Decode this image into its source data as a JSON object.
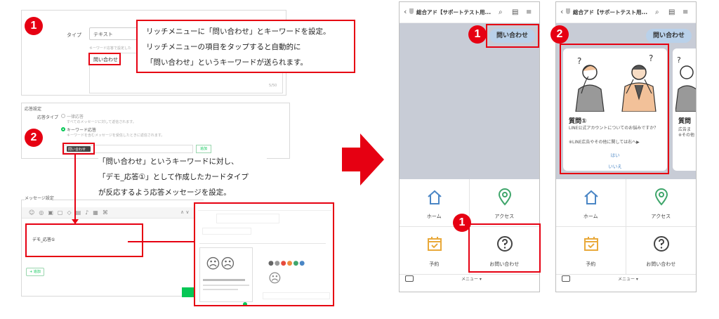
{
  "badges": [
    "1",
    "2"
  ],
  "top_panel": {
    "type_label": "タイプ",
    "type_value": "テキスト",
    "hint": "キーワード応答で設定した",
    "keyword": "問い合わせ",
    "counter": "5/50"
  },
  "callout1": {
    "line1": "リッチメニューに「問い合わせ」とキーワードを設定。",
    "line2": "リッチメニューの項目をタップすると自動的に",
    "line3": "「問い合わせ」というキーワードが送られます。"
  },
  "response_panel": {
    "heading": "応答設定",
    "type_label": "応答タイプ",
    "option1": "一律応答",
    "option1_hint": "すべてのメッセージに対して返信されます。",
    "option2": "キーワード応答",
    "option2_hint": "キーワードを含むメッセージを受信したときに返信されます。",
    "tag": "問い合わせ",
    "add_label": "追加"
  },
  "callout2": {
    "line1": "「問い合わせ」というキーワードに対し、",
    "line2": "「デモ_応答①」として作成したカードタイプ",
    "line3": "が反応するよう応答メッセージを設定。"
  },
  "message_panel": {
    "heading": "メッセージ設定",
    "message_item": "デモ_応答①",
    "add_button": "+ 追加"
  },
  "phone1": {
    "title": "総合アド【サポートテスト用...",
    "keyword_bubble": "問い合わせ",
    "menu": [
      {
        "label": "ホーム"
      },
      {
        "label": "アクセス"
      },
      {
        "label": "予約"
      },
      {
        "label": "お問い合わせ"
      }
    ],
    "footer": "メニュー ▾"
  },
  "phone2": {
    "title": "総合アド【サポートテスト用...",
    "keyword_bubble": "問い合わせ",
    "card": {
      "title": "質問①",
      "body1": "LINE公式アカウントについてのお悩みですか？",
      "body2": "※LINE広告やその他に関しては右へ▶",
      "yes": "はい",
      "no": "いいえ"
    },
    "card2": {
      "title": "質問",
      "body1": "広告ま",
      "body2": "※その他"
    },
    "menu": [
      {
        "label": "ホーム"
      },
      {
        "label": "アクセス"
      },
      {
        "label": "予約"
      },
      {
        "label": "お問い合わせ"
      }
    ],
    "footer": "メニュー ▾"
  },
  "colors": {
    "accent_red": "#e60012",
    "line_green": "#06c755",
    "chat_bg": "#c8ccd6",
    "bubble_blue": "#b9d1ea",
    "home_blue": "#4a86c5",
    "access_green": "#3fa66b",
    "calendar_yellow": "#e9a93a"
  }
}
